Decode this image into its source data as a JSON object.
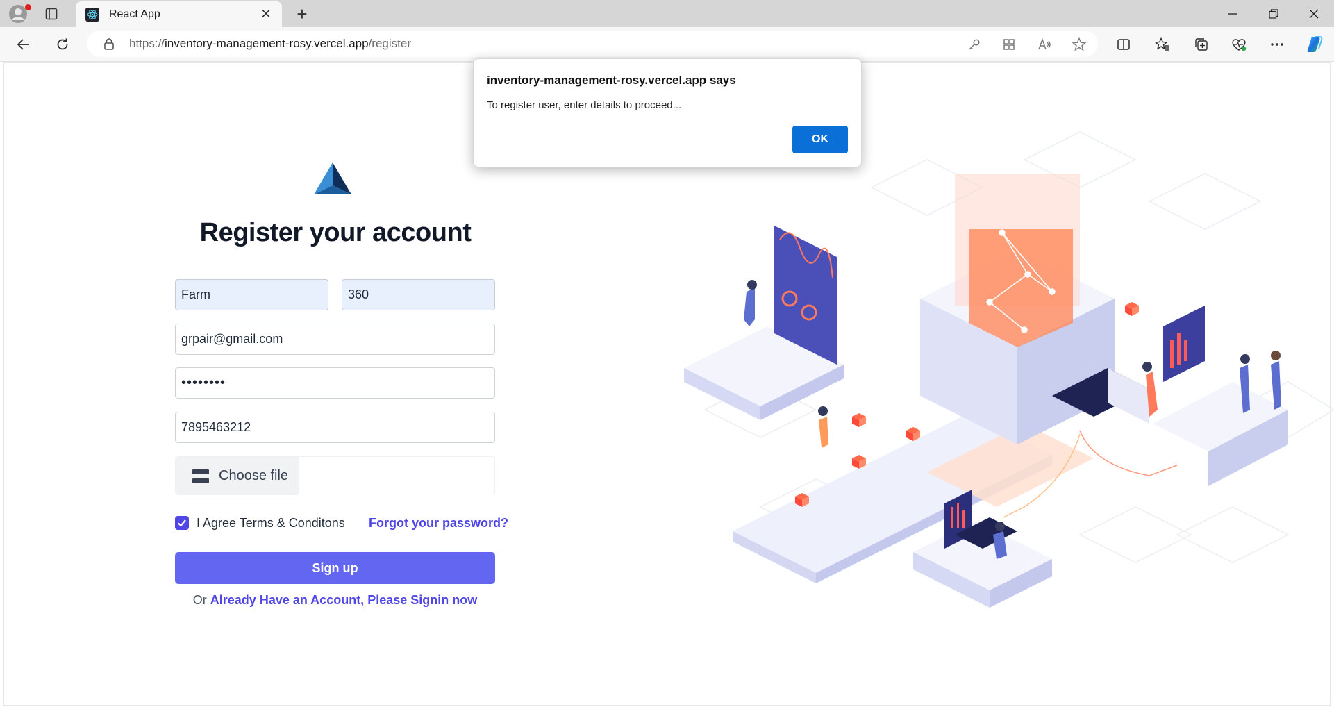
{
  "browser": {
    "tab_title": "React App",
    "url_scheme": "https://",
    "url_domain": "inventory-management-rosy.vercel.app",
    "url_path": "/register"
  },
  "page": {
    "title": "Register your account",
    "first_name_value": "Farm",
    "last_name_value": "360",
    "email_value": "grpair@gmail.com",
    "password_value": "••••••••",
    "phone_value": "7895463212",
    "file_button_label": "Choose file",
    "agree_label": "I Agree Terms & Conditons",
    "forgot_password_label": "Forgot your password?",
    "signup_label": "Sign up",
    "signin_prefix": "Or",
    "signin_link": "Already Have an Account, Please Signin now"
  },
  "dialog": {
    "title": "inventory-management-rosy.vercel.app says",
    "message": "To register user, enter details to proceed...",
    "ok_label": "OK"
  },
  "colors": {
    "primary": "#6366f1",
    "link": "#4f46e5",
    "dialog_button": "#0a6fd6"
  }
}
